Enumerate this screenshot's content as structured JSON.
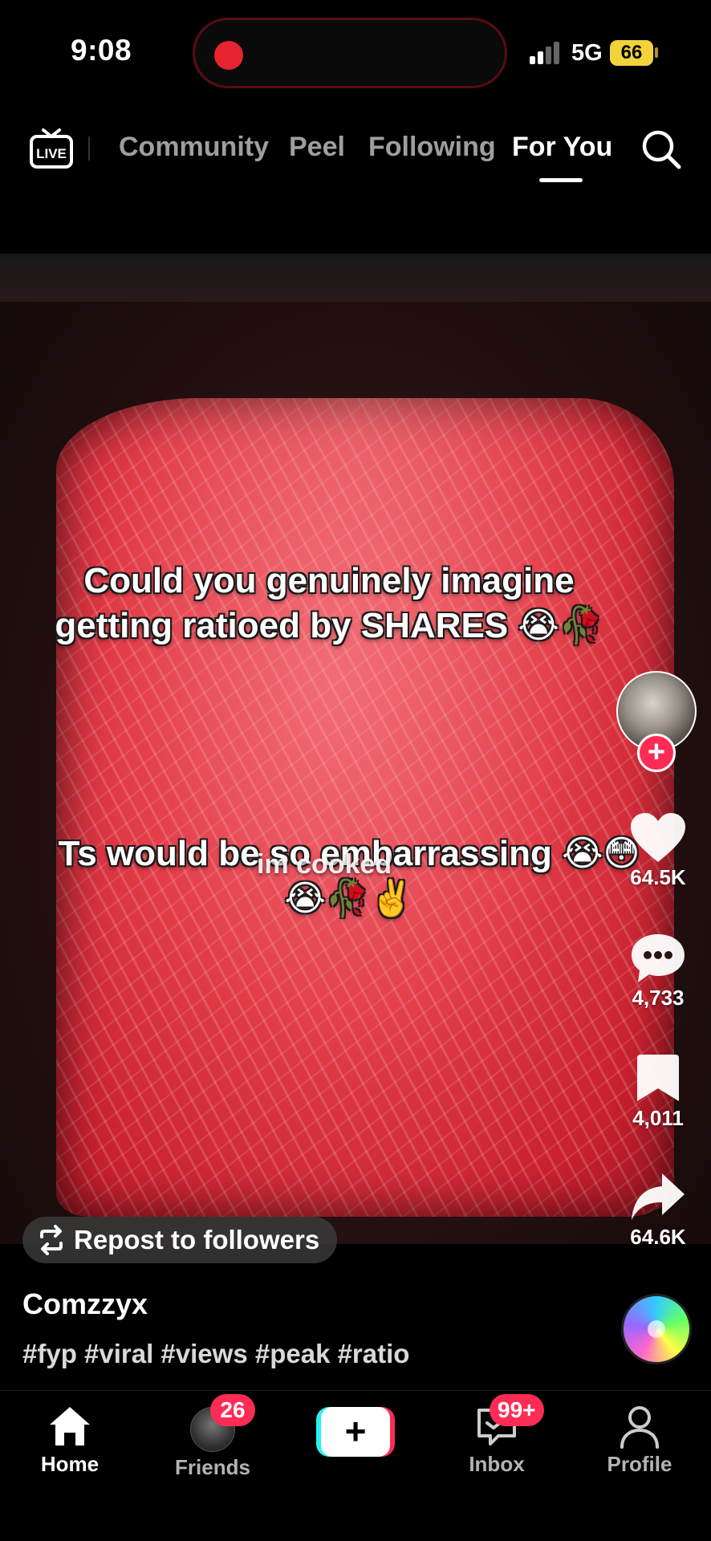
{
  "status_bar": {
    "time": "9:08",
    "network": "5G",
    "battery": "66",
    "recording_color": "#e5242f",
    "battery_color": "#f2d33a"
  },
  "top_nav": {
    "live_label": "LIVE",
    "tabs": [
      {
        "label": "Community",
        "active": false
      },
      {
        "label": "Peel",
        "active": false
      },
      {
        "label": "Following",
        "active": false
      },
      {
        "label": "For You",
        "active": true
      }
    ],
    "search_icon": "search-icon"
  },
  "video": {
    "caption_top": "Could you genuinely imagine getting ratioed by SHARES 😭🥀",
    "caption_bottom": "Ts would be so embarrassing 😭😳😭🥀✌️",
    "overlay_text": "im cooked"
  },
  "right_rail": {
    "likes": "64.5K",
    "comments": "4,733",
    "saves": "4,011",
    "shares": "64.6K",
    "follow_symbol": "+"
  },
  "repost_label": "Repost to followers",
  "post": {
    "username": "Comzzyx",
    "hashtags": "#fyp #viral #views #peak #ratio"
  },
  "bottom_nav": {
    "home": "Home",
    "friends": "Friends",
    "friends_badge": "26",
    "create_symbol": "+",
    "inbox": "Inbox",
    "inbox_badge": "99+",
    "profile": "Profile"
  },
  "colors": {
    "accent_pink": "#fe2c55",
    "accent_cyan": "#25f4ee",
    "background": "#000000"
  }
}
